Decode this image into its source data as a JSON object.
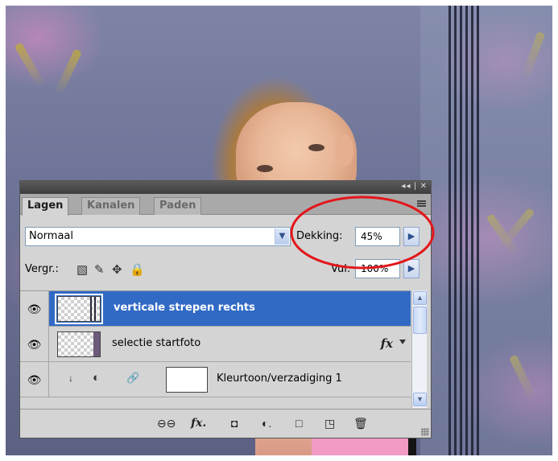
{
  "panel": {
    "controls": "◂◂ | ✕",
    "tabs": [
      "Lagen",
      "Kanalen",
      "Paden"
    ],
    "blend_mode": "Normaal",
    "opacity_label": "Dekking:",
    "opacity_value": "45%",
    "lock_label": "Vergr.:",
    "fill_label": "Vul:",
    "fill_value": "100%",
    "layers": [
      {
        "name": "verticale strepen rechts",
        "selected": true
      },
      {
        "name": "selectie startfoto",
        "has_fx": true,
        "fx_label": "fx"
      },
      {
        "name": "Kleurtoon/verzadiging 1",
        "adjustment": true
      }
    ],
    "bottom_icons": [
      "link-icon",
      "fx-icon",
      "mask-icon",
      "adjustment-icon",
      "group-icon",
      "new-layer-icon",
      "trash-icon"
    ]
  },
  "colors": {
    "selection": "#316ac5",
    "annotation": "#e3161a",
    "panel_bg": "#d4d4d4"
  }
}
